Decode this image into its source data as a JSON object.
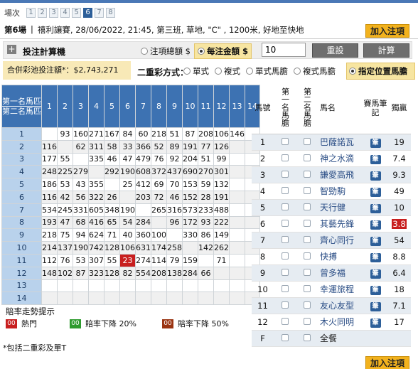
{
  "race_nav": {
    "label": "場次",
    "races": [
      "1",
      "2",
      "3",
      "4",
      "5",
      "6",
      "7",
      "8"
    ],
    "active_index": 5
  },
  "race_info": {
    "race_no": "第6場",
    "sep": "|",
    "details": "禧利讓賽, 28/06/2022, 21:45, 第三班, 草地, \"C\" , 1200米, 好地至快地"
  },
  "add_slip_label": "加入注項",
  "calc": {
    "label": "投注計算機",
    "plus": "+",
    "opt_total": "注項總額 $",
    "opt_unit": "每注金額 $",
    "amount_value": "10",
    "reset_label": "重設",
    "calc_label": "計算"
  },
  "pool": {
    "text": "合併彩池投注額*：$2,743,271"
  },
  "modes": {
    "label": "二重彩方式：",
    "items": [
      "單式",
      "複式",
      "單式馬膽",
      "複式馬膽"
    ],
    "fixed_label": "指定位置馬膽"
  },
  "grid": {
    "corner_top": "第一名馬匹",
    "corner_bottom": "第二名馬匹",
    "cols": [
      "1",
      "2",
      "3",
      "4",
      "5",
      "6",
      "7",
      "8",
      "9",
      "10",
      "11",
      "12",
      "13",
      "14"
    ],
    "rows": [
      {
        "label": "1",
        "cells": [
          "",
          "93",
          "160",
          "271",
          "167",
          "84",
          "60",
          "218",
          "51",
          "87",
          "208",
          "106",
          "146",
          ""
        ]
      },
      {
        "label": "2",
        "cells": [
          "116",
          "",
          "62",
          "311",
          "58",
          "33",
          "366",
          "52",
          "89",
          "191",
          "77",
          "126",
          "",
          ""
        ]
      },
      {
        "label": "3",
        "cells": [
          "177",
          "55",
          "",
          "335",
          "46",
          "47",
          "479",
          "76",
          "92",
          "204",
          "51",
          "99",
          "",
          ""
        ]
      },
      {
        "label": "4",
        "cells": [
          "248",
          "225",
          "279",
          "",
          "292",
          "190",
          "608",
          "372",
          "437",
          "690",
          "270",
          "301",
          "",
          ""
        ]
      },
      {
        "label": "5",
        "cells": [
          "186",
          "53",
          "43",
          "355",
          "",
          "25",
          "412",
          "69",
          "70",
          "153",
          "59",
          "132",
          "",
          ""
        ]
      },
      {
        "label": "6",
        "cells": [
          "116",
          "42",
          "56",
          "322",
          "26",
          "",
          "203",
          "72",
          "46",
          "152",
          "28",
          "191",
          "",
          ""
        ]
      },
      {
        "label": "7",
        "cells": [
          "534",
          "245",
          "331",
          "605",
          "348",
          "190",
          "",
          "265",
          "316",
          "573",
          "233",
          "488",
          "",
          ""
        ]
      },
      {
        "label": "8",
        "cells": [
          "193",
          "47",
          "68",
          "416",
          "65",
          "54",
          "284",
          "",
          "96",
          "172",
          "93",
          "222",
          "",
          ""
        ]
      },
      {
        "label": "9",
        "cells": [
          "218",
          "75",
          "94",
          "624",
          "71",
          "40",
          "360",
          "100",
          "",
          "330",
          "86",
          "149",
          "",
          ""
        ]
      },
      {
        "label": "10",
        "cells": [
          "214",
          "137",
          "190",
          "742",
          "128",
          "106",
          "631",
          "174",
          "258",
          "",
          "142",
          "262",
          "",
          ""
        ]
      },
      {
        "label": "11",
        "cells": [
          "112",
          "76",
          "53",
          "307",
          "55",
          "23",
          "274",
          "114",
          "79",
          "159",
          "",
          "71",
          "",
          ""
        ]
      },
      {
        "label": "12",
        "cells": [
          "148",
          "102",
          "87",
          "323",
          "128",
          "82",
          "554",
          "208",
          "138",
          "284",
          "66",
          "",
          "",
          ""
        ]
      },
      {
        "label": "13",
        "cells": [
          "",
          "",
          "",
          "",
          "",
          "",
          "",
          "",
          "",
          "",
          "",
          "",
          "",
          ""
        ]
      },
      {
        "label": "14",
        "cells": [
          "",
          "",
          "",
          "",
          "",
          "",
          "",
          "",
          "",
          "",
          "",
          "",
          "",
          ""
        ]
      }
    ],
    "hot_cell": {
      "row": 10,
      "col": 5
    }
  },
  "legend": {
    "title": "賠率走勢提示",
    "items": [
      {
        "code": "00",
        "label": "熱門",
        "color": "#c81f1f"
      },
      {
        "code": "00",
        "label": "賠率下降 20%",
        "color": "#2e9b2e"
      },
      {
        "code": "00",
        "label": "賠率下降 50%",
        "color": "#9a3412"
      }
    ]
  },
  "footnote": "*包括二重彩及單T",
  "horse_table": {
    "headers": {
      "no": "馬號",
      "first": "第一名馬膽",
      "second": "第二名馬膽",
      "name": "馬名",
      "note": "賽馬筆記",
      "odds": "獨贏"
    },
    "horses": [
      {
        "no": "1",
        "name": "巴薩諾瓦",
        "odds": "19",
        "hot": false
      },
      {
        "no": "2",
        "name": "神之水滴",
        "odds": "7.4",
        "hot": false
      },
      {
        "no": "3",
        "name": "謙愛高飛",
        "odds": "9.3",
        "hot": false
      },
      {
        "no": "4",
        "name": "智勁駒",
        "odds": "49",
        "hot": false
      },
      {
        "no": "5",
        "name": "天行健",
        "odds": "10",
        "hot": false
      },
      {
        "no": "6",
        "name": "其藝先鋒",
        "odds": "3.8",
        "hot": true
      },
      {
        "no": "7",
        "name": "齊心同行",
        "odds": "54",
        "hot": false
      },
      {
        "no": "8",
        "name": "快搏",
        "odds": "8.8",
        "hot": false
      },
      {
        "no": "9",
        "name": "曾多福",
        "odds": "6.4",
        "hot": false
      },
      {
        "no": "10",
        "name": "幸運旅程",
        "odds": "18",
        "hot": false
      },
      {
        "no": "11",
        "name": "友心友型",
        "odds": "7.1",
        "hot": false
      },
      {
        "no": "12",
        "name": "木火同明",
        "odds": "17",
        "hot": false
      }
    ],
    "field_label": "F",
    "all_label": "全餐"
  },
  "note_icon": "筆"
}
